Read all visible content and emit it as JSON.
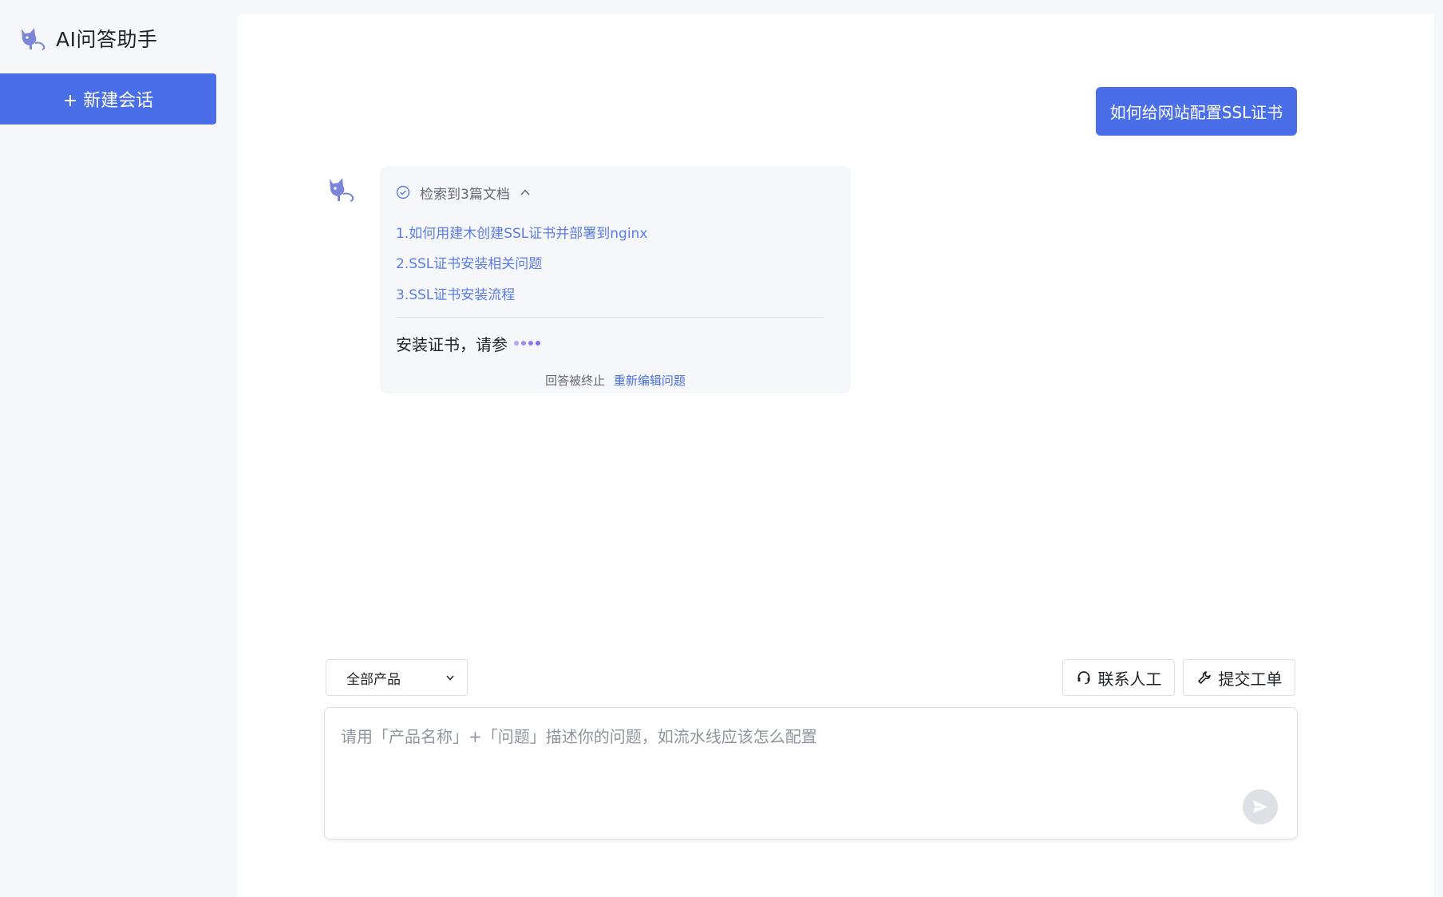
{
  "app": {
    "title": "AI问答助手"
  },
  "sidebar": {
    "new_chat_label": "+ 新建会话"
  },
  "conversation": {
    "user_message": "如何给网站配置SSL证书",
    "bot": {
      "retrieval_summary": "检索到3篇文档",
      "documents": [
        "1.如何用建木创建SSL证书并部署到nginx",
        "2.SSL证书安装相关问题",
        "3.SSL证书安装流程"
      ],
      "answer_text": "安装证书，请参",
      "status_text": "回答被终止",
      "reedit_label": "重新编辑问题"
    }
  },
  "composer": {
    "product_select": "全部产品",
    "contact_human_label": "联系人工",
    "submit_ticket_label": "提交工单",
    "input_placeholder": "请用「产品名称」+「问题」描述你的问题，如流水线应该怎么配置"
  },
  "icons": {
    "logo": "cat-logo-icon",
    "retrieval": "check-circle-icon",
    "collapse": "chevron-up-icon",
    "dropdown": "chevron-down-icon",
    "human": "headset-icon",
    "ticket": "wrench-icon",
    "send": "send-icon"
  },
  "colors": {
    "accent": "#4a6ee8",
    "link": "#5b7ce6",
    "logo": "#7b86d8",
    "dots": [
      "#b7a6f0",
      "#9f8ff0",
      "#8a7ef0",
      "#7b73f0"
    ]
  }
}
